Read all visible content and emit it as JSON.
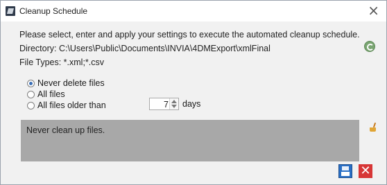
{
  "window": {
    "title": "Cleanup Schedule",
    "close_glyph": "×"
  },
  "info": {
    "instruction": "Please select, enter and apply your settings to execute the automated cleanup schedule.",
    "directory": "Directory: C:\\Users\\Public\\Documents\\INVIA\\4DMExport\\xmlFinal",
    "file_types": "File Types: *.xml;*.csv"
  },
  "options": [
    {
      "label": "Never delete files",
      "selected": true
    },
    {
      "label": "All files",
      "selected": false
    },
    {
      "label": "All files older than",
      "selected": false
    }
  ],
  "days": {
    "value": "7",
    "unit": "days"
  },
  "description": "Never clean up files.",
  "actions": {
    "cancel_glyph": "✕"
  },
  "icons": {
    "app": "app-logo-icon",
    "refresh": "refresh-icon",
    "broom": "broom-icon",
    "save": "save-icon",
    "cancel": "cancel-icon"
  },
  "colors": {
    "content_bg": "#f1f1f1",
    "description_bg": "#a8a8a8",
    "save_blue": "#2a6fc5",
    "cancel_red": "#d73636"
  }
}
